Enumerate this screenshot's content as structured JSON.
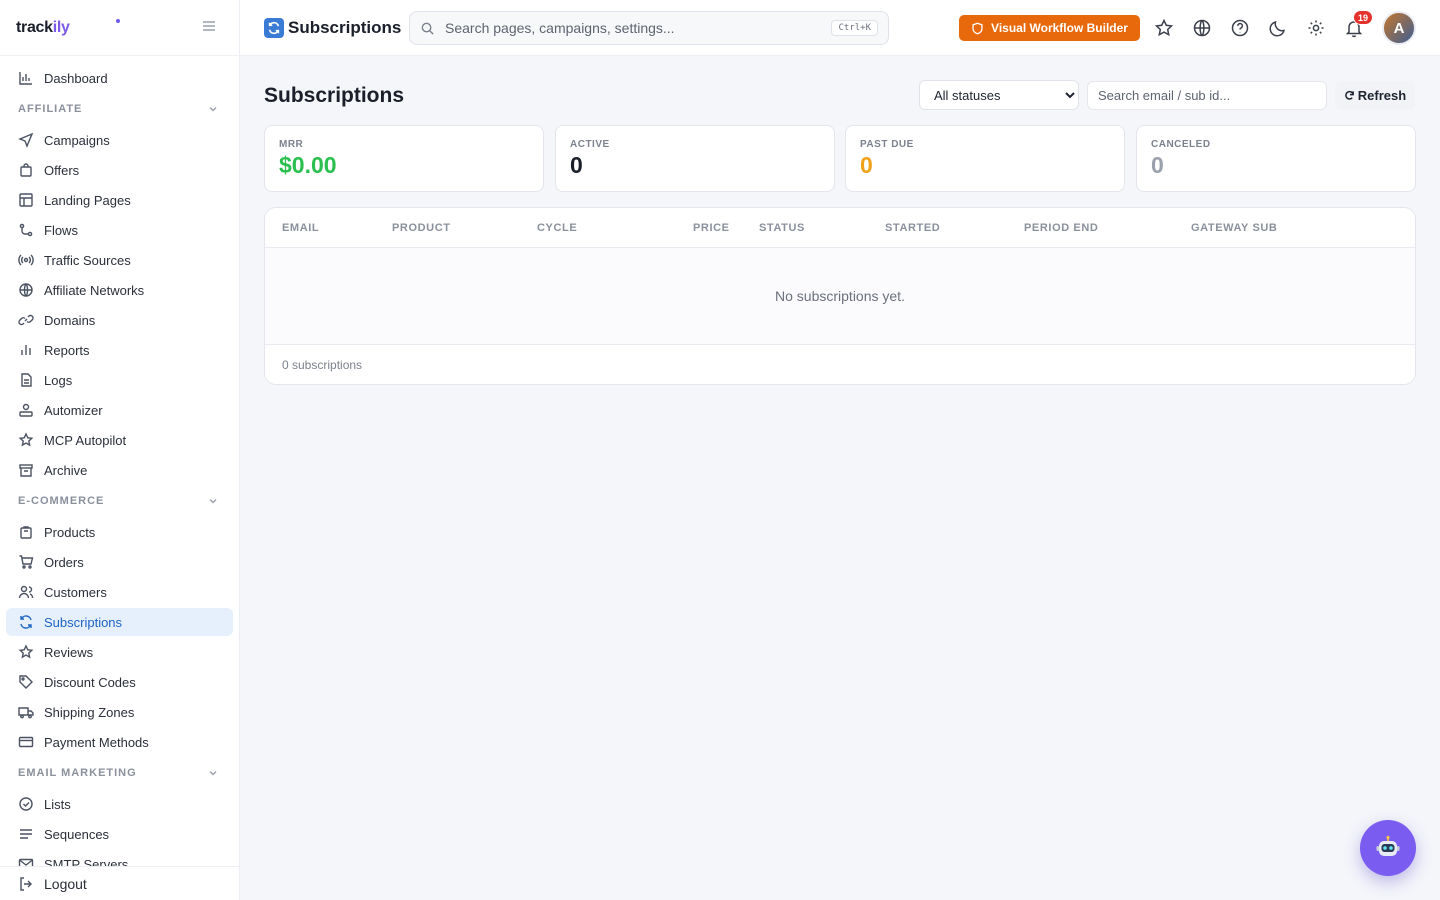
{
  "brand": {
    "name_a": "track",
    "name_b": "ily"
  },
  "sidebar": {
    "top_items": [
      {
        "label": "Dashboard",
        "icon": "chart-icon"
      }
    ],
    "sections": [
      {
        "title": "AFFILIATE",
        "items": [
          {
            "label": "Campaigns",
            "icon": "send-icon"
          },
          {
            "label": "Offers",
            "icon": "bag-icon"
          },
          {
            "label": "Landing Pages",
            "icon": "layout-icon"
          },
          {
            "label": "Flows",
            "icon": "flow-icon"
          },
          {
            "label": "Traffic Sources",
            "icon": "broadcast-icon"
          },
          {
            "label": "Affiliate Networks",
            "icon": "globe-icon"
          },
          {
            "label": "Domains",
            "icon": "link-icon"
          },
          {
            "label": "Reports",
            "icon": "bar-chart-icon"
          },
          {
            "label": "Logs",
            "icon": "file-icon"
          },
          {
            "label": "Automizer",
            "icon": "automizer-icon"
          },
          {
            "label": "MCP Autopilot",
            "icon": "sparkle-star-icon"
          },
          {
            "label": "Archive",
            "icon": "archive-icon"
          }
        ]
      },
      {
        "title": "E-COMMERCE",
        "items": [
          {
            "label": "Products",
            "icon": "package-icon"
          },
          {
            "label": "Orders",
            "icon": "cart-icon"
          },
          {
            "label": "Customers",
            "icon": "users-icon"
          },
          {
            "label": "Subscriptions",
            "icon": "refresh-icon",
            "active": true
          },
          {
            "label": "Reviews",
            "icon": "star-icon"
          },
          {
            "label": "Discount Codes",
            "icon": "tag-icon"
          },
          {
            "label": "Shipping Zones",
            "icon": "truck-icon"
          },
          {
            "label": "Payment Methods",
            "icon": "card-icon"
          }
        ]
      },
      {
        "title": "EMAIL MARKETING",
        "items": [
          {
            "label": "Lists",
            "icon": "check-circle-icon"
          },
          {
            "label": "Sequences",
            "icon": "lines-icon"
          },
          {
            "label": "SMTP Servers",
            "icon": "mail-icon"
          }
        ]
      }
    ],
    "logout_label": "Logout"
  },
  "topbar": {
    "page_title": "Subscriptions",
    "search_placeholder": "Search pages, campaigns, settings...",
    "search_shortcut": "Ctrl+K",
    "workflow_button": "Visual Workflow Builder",
    "notification_count": "19",
    "avatar_initial": "A"
  },
  "page": {
    "title": "Subscriptions",
    "status_filter": {
      "selected": "All statuses",
      "options": [
        "All statuses"
      ]
    },
    "search_placeholder": "Search email / sub id...",
    "refresh_label": "Refresh"
  },
  "stats": [
    {
      "label": "MRR",
      "value": "$0.00",
      "color": "#2bbf4f"
    },
    {
      "label": "ACTIVE",
      "value": "0",
      "color": "#1b1f2a"
    },
    {
      "label": "PAST DUE",
      "value": "0",
      "color": "#f0a11a"
    },
    {
      "label": "CANCELED",
      "value": "0",
      "color": "#9aa0ac"
    }
  ],
  "table": {
    "columns": [
      "EMAIL",
      "PRODUCT",
      "CYCLE",
      "PRICE",
      "STATUS",
      "STARTED",
      "PERIOD END",
      "GATEWAY SUB"
    ],
    "empty_message": "No subscriptions yet.",
    "footer": "0 subscriptions"
  },
  "colors": {
    "accent": "#1d64c4",
    "workflow": "#e8690c",
    "fab": "#7b5cf0"
  }
}
